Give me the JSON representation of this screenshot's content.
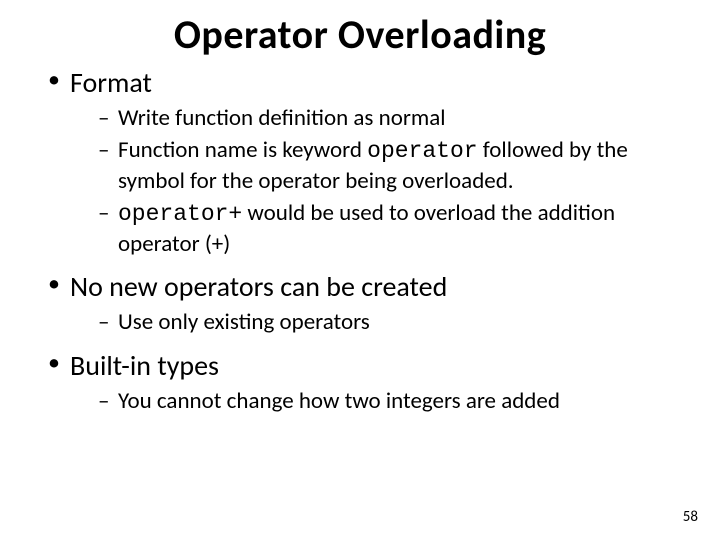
{
  "title": "Operator Overloading",
  "bullets": [
    {
      "text": "Format",
      "sub": [
        {
          "text": "Write function definition as normal"
        },
        {
          "pre": "Function name is keyword ",
          "code": "operator",
          "post": " followed by the symbol for the operator being overloaded."
        },
        {
          "code": "operator+",
          "post": " would be used to overload the addition operator (+)"
        }
      ]
    },
    {
      "text": "No new operators can be created",
      "sub": [
        {
          "text": "Use only existing operators"
        }
      ]
    },
    {
      "text": "Built-in types",
      "sub": [
        {
          "text": "You cannot change how two integers are added"
        }
      ]
    }
  ],
  "page_number": "58"
}
